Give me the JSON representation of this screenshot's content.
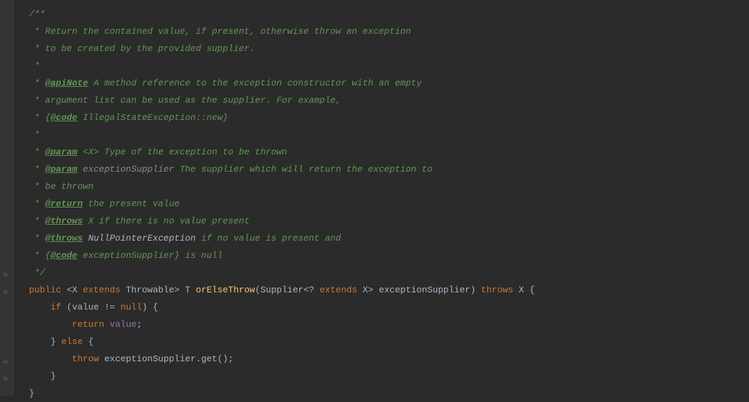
{
  "code": {
    "l1": "/**",
    "l2a": " * ",
    "l2b": "Return the contained value, if present, otherwise throw an exception",
    "l3a": " * ",
    "l3b": "to be created by the provided supplier.",
    "l4": " *",
    "l5a": " * ",
    "l5tag": "@apiNote",
    "l5b": " A method reference to the exception constructor with an empty",
    "l6a": " * ",
    "l6b": "argument list can be used as the supplier. For example,",
    "l7a": " * ",
    "l7b": "{",
    "l7tag": "@code",
    "l7c": " IllegalStateException::new}",
    "l8": " *",
    "l9a": " * ",
    "l9tag": "@param",
    "l9type": " <X>",
    "l9b": " Type of the exception to be thrown",
    "l10a": " * ",
    "l10tag": "@param",
    "l10name": " exceptionSupplier",
    "l10b": " The supplier which will return the exception to",
    "l11a": " * ",
    "l11b": "be thrown",
    "l12a": " * ",
    "l12tag": "@return",
    "l12b": " the present value",
    "l13a": " * ",
    "l13tag": "@throws",
    "l13b": " X if there is no value present",
    "l14a": " * ",
    "l14tag": "@throws",
    "l14class": " NullPointerException",
    "l14b": " if no value is present and",
    "l15a": " * ",
    "l15b": "{",
    "l15tag": "@code",
    "l15c": " exceptionSupplier}",
    "l15d": " is null",
    "l16": " */",
    "l17_public": "public",
    "l17_open": " <",
    "l17_x": "X ",
    "l17_extends": "extends",
    "l17_throwable": " Throwable",
    "l17_close": "> ",
    "l17_t": "T ",
    "l17_method": "orElseThrow",
    "l17_paren1": "(",
    "l17_supplier": "Supplier",
    "l17_open2": "<",
    "l17_q": "? ",
    "l17_extends2": "extends",
    "l17_x2": " X",
    "l17_close2": "> ",
    "l17_param": "exceptionSupplier",
    "l17_paren2": ") ",
    "l17_throws": "throws",
    "l17_x3": " X ",
    "l17_brace": "{",
    "l18_if": "if",
    "l18_paren1": " (",
    "l18_value": "value ",
    "l18_op": "!= ",
    "l18_null": "null",
    "l18_paren2": ") ",
    "l18_brace": "{",
    "l19_return": "return",
    "l19_sp": " ",
    "l19_value": "value",
    "l19_semi": ";",
    "l20_brace": "} ",
    "l20_else": "else",
    "l20_brace2": " {",
    "l21_throw": "throw",
    "l21_sp": " ",
    "l21_id": "exceptionSupplier.get()",
    "l21_semi": ";",
    "l22": "}",
    "l23": "}"
  }
}
